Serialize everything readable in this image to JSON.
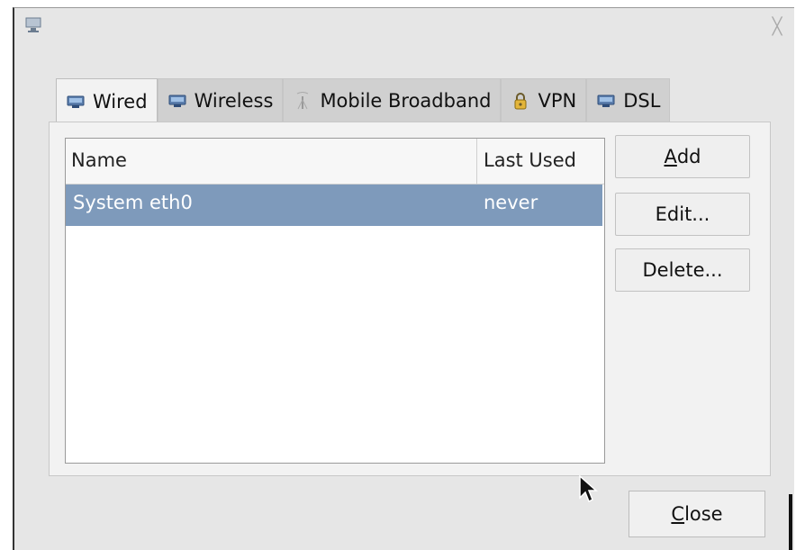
{
  "window": {
    "app_icon": "network-manager-icon",
    "close_icon": "close-icon",
    "close_glyph": "╳"
  },
  "tabs": [
    {
      "label": "Wired",
      "icon": "wired-network-icon",
      "active": true
    },
    {
      "label": "Wireless",
      "icon": "wireless-network-icon",
      "active": false
    },
    {
      "label": "Mobile Broadband",
      "icon": "mobile-broadband-icon",
      "active": false
    },
    {
      "label": "VPN",
      "icon": "vpn-lock-icon",
      "active": false
    },
    {
      "label": "DSL",
      "icon": "dsl-network-icon",
      "active": false
    }
  ],
  "list": {
    "columns": [
      "Name",
      "Last Used"
    ],
    "rows": [
      {
        "name": "System eth0",
        "last_used": "never",
        "selected": true
      }
    ]
  },
  "buttons": {
    "add_prefix": "A",
    "add_rest": "dd",
    "edit": "Edit...",
    "delete": "Delete...",
    "close_prefix": "C",
    "close_rest": "lose"
  },
  "colors": {
    "selection": "#7e9abb",
    "dialog_bg": "#e6e6e6"
  }
}
